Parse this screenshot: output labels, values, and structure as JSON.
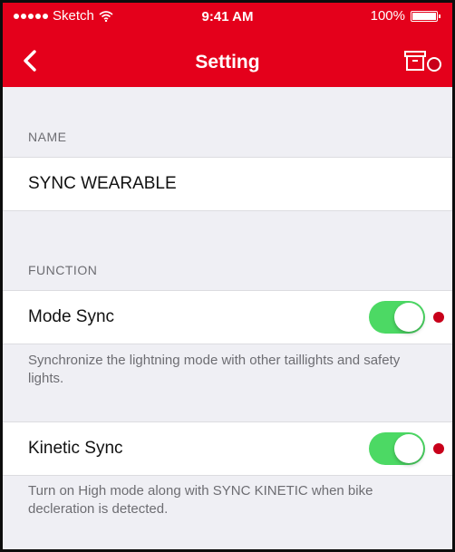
{
  "status_bar": {
    "carrier": "Sketch",
    "time": "9:41 AM",
    "battery": "100%"
  },
  "nav": {
    "title": "Setting",
    "back_icon": "chevron-left-icon",
    "action_icon": "archive-box-icon"
  },
  "sections": {
    "name": {
      "header": "NAME",
      "value": "SYNC WEARABLE"
    },
    "function": {
      "header": "FUNCTION",
      "items": [
        {
          "label": "Mode Sync",
          "enabled": true,
          "description": "Synchronize the lightning mode with other taillights and safety lights."
        },
        {
          "label": "Kinetic Sync",
          "enabled": true,
          "description": "Turn on High mode along with SYNC KINETIC when bike decleration is detected."
        }
      ]
    }
  },
  "colors": {
    "brand_red": "#e4001b",
    "toggle_on": "#4cd964",
    "background": "#efeff4",
    "secondary_text": "#6d6d72"
  }
}
